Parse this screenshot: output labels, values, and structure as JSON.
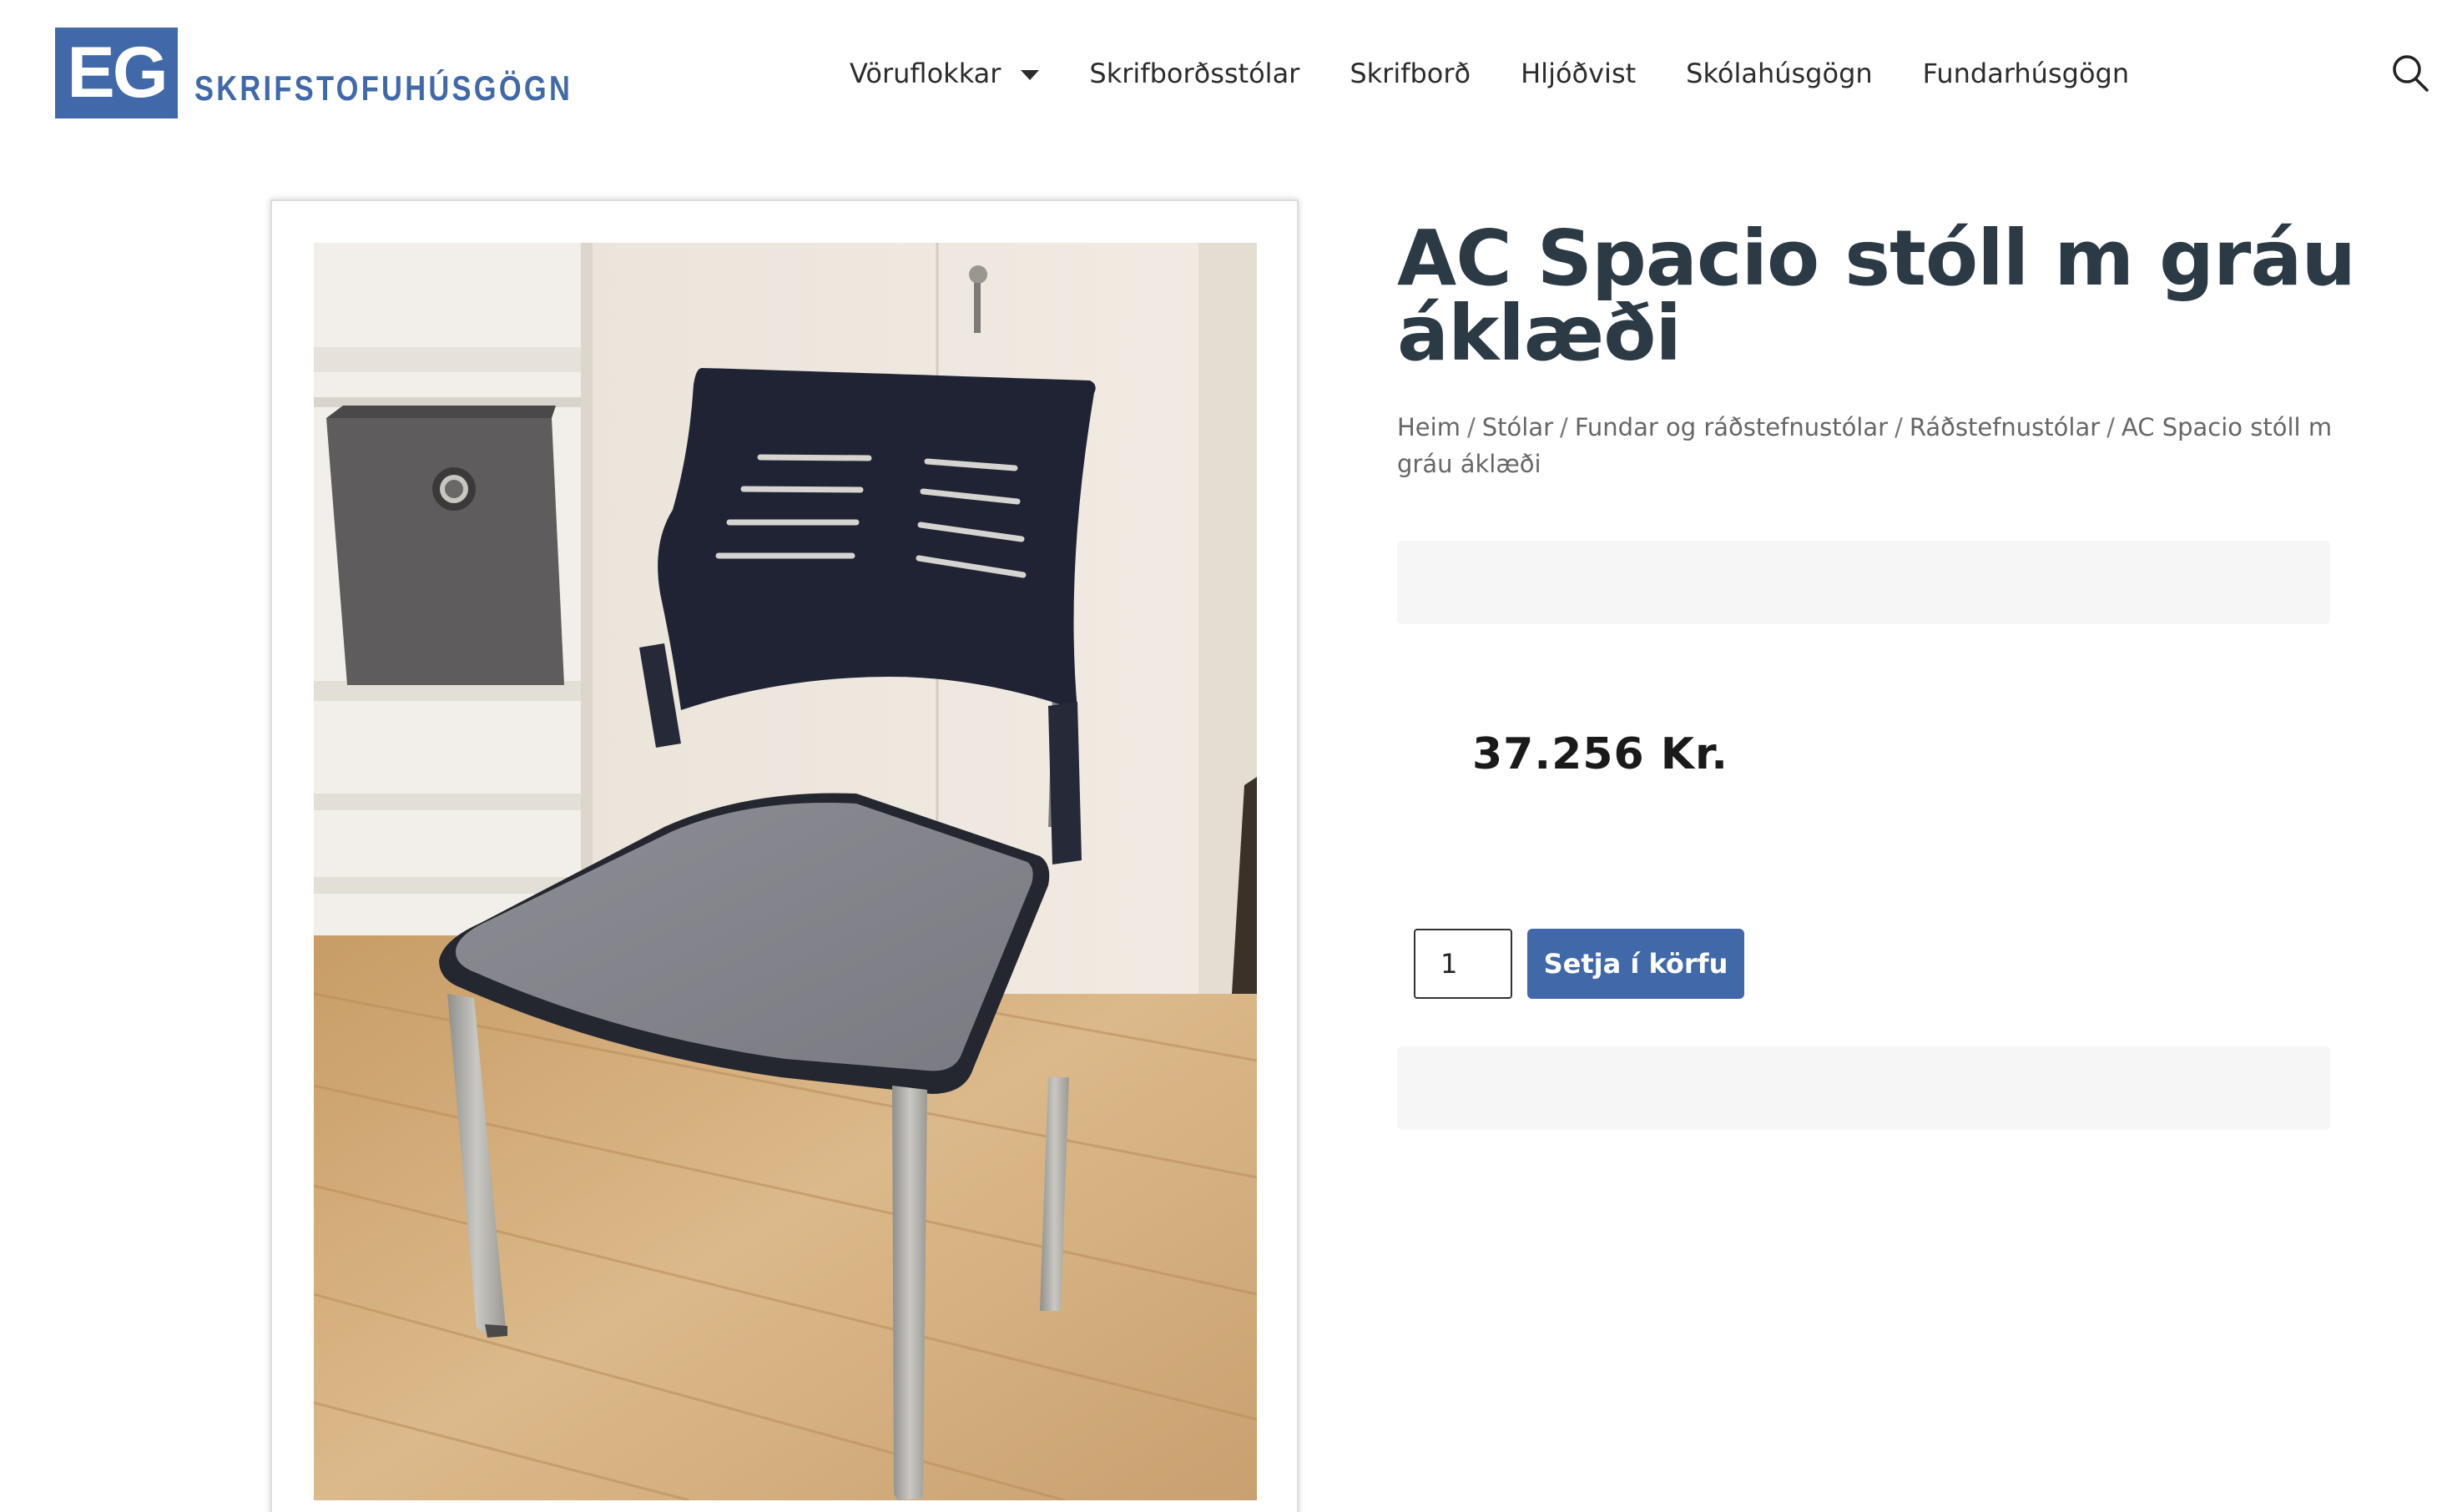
{
  "brand": {
    "logo_mark": "EG",
    "logo_text": "SKRIFSTOFUHÚSGÖGN",
    "color": "#4169a9"
  },
  "nav": {
    "items": [
      {
        "label": "Vöruflokkar",
        "has_dropdown": true
      },
      {
        "label": "Skrifborðsstólar"
      },
      {
        "label": "Skrifborð"
      },
      {
        "label": "Hljóðvist"
      },
      {
        "label": "Skólahúsgögn"
      },
      {
        "label": "Fundarhúsgögn"
      }
    ],
    "search_icon": "search-icon"
  },
  "product": {
    "title": "AC Spacio stóll m gráu áklæði",
    "price": "37.256 Kr.",
    "quantity": "1",
    "add_to_cart_label": "Setja í körfu",
    "image_alt": "chair-photo"
  },
  "breadcrumb": {
    "items": [
      "Heim",
      "Stólar",
      "Fundar og ráðstefnustólar",
      "Ráðstefnustólar"
    ],
    "current": "AC Spacio stóll m gráu áklæði"
  },
  "colors": {
    "accent": "#4169a9",
    "title": "#2b3a44",
    "panel": "#f6f6f6"
  }
}
